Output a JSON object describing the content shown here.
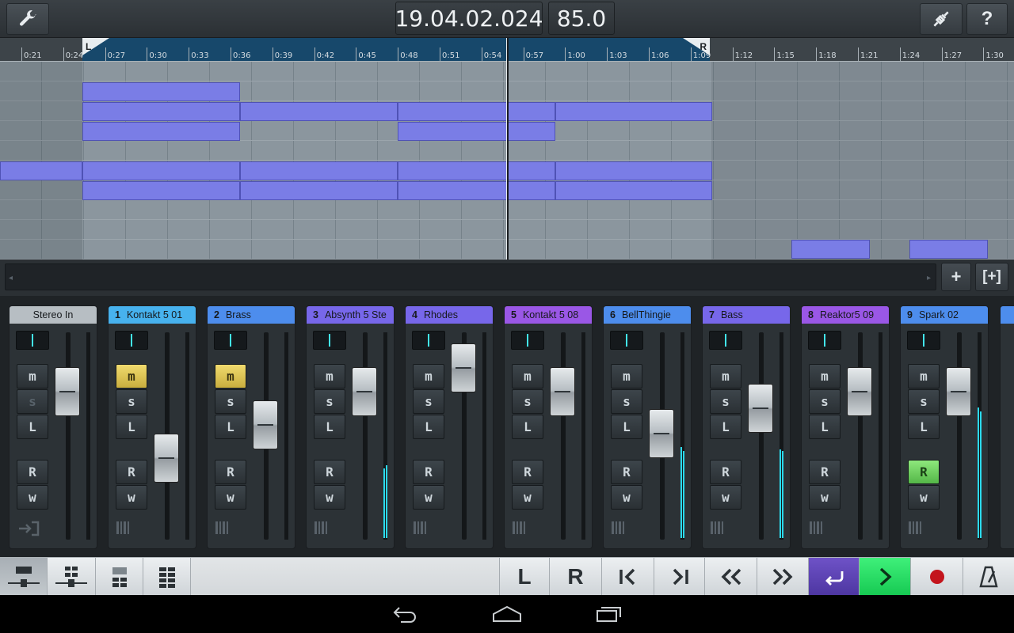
{
  "topbar": {
    "time_display": "19.04.02.024",
    "tempo_display": "85.0",
    "wrench_icon": "wrench-icon",
    "connect_icon": "plug-icon",
    "help_label": "?"
  },
  "ruler": {
    "locator_left": "L",
    "locator_right": "R",
    "ticks": [
      "0:21",
      "0:24",
      "0:27",
      "0:30",
      "0:33",
      "0:36",
      "0:39",
      "0:42",
      "0:45",
      "0:48",
      "0:51",
      "0:54",
      "0:57",
      "1:00",
      "1:03",
      "1:06",
      "1:09",
      "1:12",
      "1:15",
      "1:18",
      "1:21",
      "1:24",
      "1:27",
      "1:30"
    ]
  },
  "arrange": {
    "parts_color": "#7a7de6",
    "add_track_label": "+",
    "add_track_folder_label": "[+]"
  },
  "mixer": {
    "channels": [
      {
        "num": "",
        "name": "Stereo In",
        "color": "#b7bec3",
        "m_on": false,
        "r_on": false,
        "s_dim": true
      },
      {
        "num": "1",
        "name": "Kontakt 5 01",
        "color": "#47b2ee",
        "m_on": true,
        "r_on": false,
        "s_dim": false
      },
      {
        "num": "2",
        "name": "Brass",
        "color": "#4d8ded",
        "m_on": true,
        "r_on": false,
        "s_dim": false
      },
      {
        "num": "3",
        "name": "Absynth 5 Ste",
        "color": "#7767ea",
        "m_on": false,
        "r_on": false,
        "s_dim": false
      },
      {
        "num": "4",
        "name": "Rhodes",
        "color": "#7767ea",
        "m_on": false,
        "r_on": false,
        "s_dim": false
      },
      {
        "num": "5",
        "name": "Kontakt 5 08",
        "color": "#9a57e6",
        "m_on": false,
        "r_on": false,
        "s_dim": false
      },
      {
        "num": "6",
        "name": "BellThingie",
        "color": "#4d8ded",
        "m_on": false,
        "r_on": false,
        "s_dim": false
      },
      {
        "num": "7",
        "name": "Bass",
        "color": "#7767ea",
        "m_on": false,
        "r_on": false,
        "s_dim": false
      },
      {
        "num": "8",
        "name": "Reaktor5 09",
        "color": "#9a57e6",
        "m_on": false,
        "r_on": false,
        "s_dim": false
      },
      {
        "num": "9",
        "name": "Spark 02",
        "color": "#4d8ded",
        "m_on": false,
        "r_on": true,
        "s_dim": false
      }
    ],
    "btn_m": "m",
    "btn_s": "s",
    "btn_l": "L",
    "btn_r": "R",
    "btn_w": "w"
  },
  "toolbar": {
    "locator_l": "L",
    "locator_r": "R",
    "colors": {
      "cycle": "#5b40b5",
      "play": "#22d75d",
      "record": "#c3141c"
    }
  }
}
